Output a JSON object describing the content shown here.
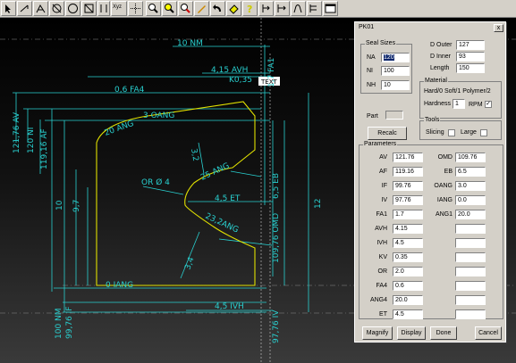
{
  "toolbar": {
    "icons": [
      "pointer-icon",
      "rotate-icon",
      "tangent-icon",
      "crosshair-icon",
      "circle-icon",
      "box-icon",
      "dim-icon",
      "xyz-icon",
      "grid-icon",
      "zoom-icon",
      "zoom-window-icon",
      "pan-icon",
      "pen-icon",
      "undo-icon",
      "eraser-icon",
      "help-icon",
      "text-icon",
      "text-dim-icon",
      "arc-dim-icon",
      "ruler-icon",
      "window-icon"
    ],
    "xyz_label": "Xyz"
  },
  "drawing": {
    "dims": {
      "nm_top": "10 NM",
      "avh": "4,15 AVH",
      "kv": "K0,35",
      "text_tag": "TEXT",
      "fa1": "1,7 FA1",
      "fa4": "0,6 FA4",
      "av": "121,76 AV",
      "ni": "120 NI",
      "af": "119,16 AF",
      "ang20": "20 ANG",
      "oang": "3 OANG",
      "dim32": "3,2",
      "ang25": "25 ANG",
      "or": "OR Ø 4",
      "et": "4,5 ET",
      "eb": "6,5 EB",
      "dim12": "12",
      "omd": "109,76 OMD",
      "ten": "10",
      "nine7": "9,7",
      "ang23": "23,2ANG",
      "dim34": "3,4",
      "iang": "0 IANG",
      "nm100": "100 NM",
      "if": "99,76 IF",
      "ivh": "4,5 IVH",
      "iv": "97,76 IV"
    }
  },
  "dialog": {
    "title": "PK01",
    "close": "x",
    "seal_sizes": {
      "legend": "Seal Sizes",
      "na_label": "NA",
      "na_value": "120",
      "ni_label": "NI",
      "ni_value": "100",
      "nh_label": "NH",
      "nh_value": "10"
    },
    "d_outer_label": "D Outer",
    "d_outer_value": "127",
    "d_inner_label": "D Inner",
    "d_inner_value": "93",
    "length_label": "Length",
    "length_value": "150",
    "material": {
      "legend": "Material",
      "text": "Hard/0 Soft/1 Polymer/2",
      "hardness_label": "Hardness",
      "hardness_value": "1",
      "rpm_label": "RPM",
      "rpm_checked": "✓"
    },
    "part_label": "Part",
    "tools": {
      "legend": "Tools",
      "slicing_label": "Slicing",
      "large_label": "Large"
    },
    "recalc": "Recalc",
    "parameters": {
      "legend": "Parameters",
      "left": [
        {
          "label": "AV",
          "value": "121.76"
        },
        {
          "label": "AF",
          "value": "119.16"
        },
        {
          "label": "IF",
          "value": "99.76"
        },
        {
          "label": "IV",
          "value": "97.76"
        },
        {
          "label": "FA1",
          "value": "1.7"
        },
        {
          "label": "AVH",
          "value": "4.15"
        },
        {
          "label": "IVH",
          "value": "4.5"
        },
        {
          "label": "KV",
          "value": "0.35"
        },
        {
          "label": "OR",
          "value": "2.0"
        },
        {
          "label": "FA4",
          "value": "0.6"
        },
        {
          "label": "ANG4",
          "value": "20.0"
        },
        {
          "label": "ET",
          "value": "4.5"
        }
      ],
      "right": [
        {
          "label": "OMD",
          "value": "109.76"
        },
        {
          "label": "EB",
          "value": "6.5"
        },
        {
          "label": "OANG",
          "value": "3.0"
        },
        {
          "label": "IANG",
          "value": "0.0"
        },
        {
          "label": "ANG1",
          "value": "20.0"
        }
      ]
    },
    "buttons": {
      "magnify": "Magnify",
      "display": "Display",
      "done": "Done",
      "cancel": "Cancel"
    }
  }
}
